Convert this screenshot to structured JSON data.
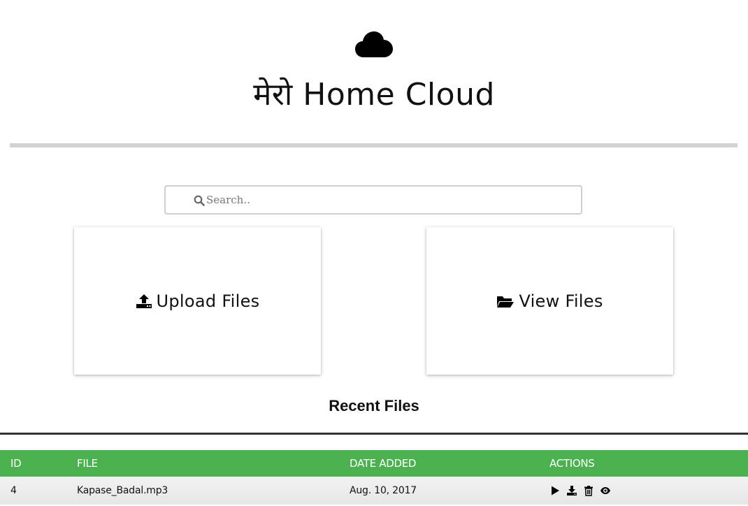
{
  "header": {
    "icon": "cloud-icon",
    "title": "मेरो Home Cloud"
  },
  "search": {
    "icon": "search-icon",
    "placeholder": "Search..",
    "value": ""
  },
  "cards": {
    "upload": {
      "icon": "upload-icon",
      "label": "Upload Files"
    },
    "view": {
      "icon": "folder-open-icon",
      "label": "View Files"
    }
  },
  "recent": {
    "title": "Recent Files",
    "columns": [
      "ID",
      "FILE",
      "DATE ADDED",
      "ACTIONS"
    ],
    "rows": [
      {
        "id": "4",
        "file": "Kapase_Badal.mp3",
        "date_added": "Aug. 10, 2017",
        "actions": [
          "play-icon",
          "download-icon",
          "trash-icon",
          "eye-icon"
        ]
      }
    ]
  },
  "colors": {
    "header_bg": "#4caf50",
    "header_text": "#ffffff",
    "divider": "#d3d3d3"
  }
}
